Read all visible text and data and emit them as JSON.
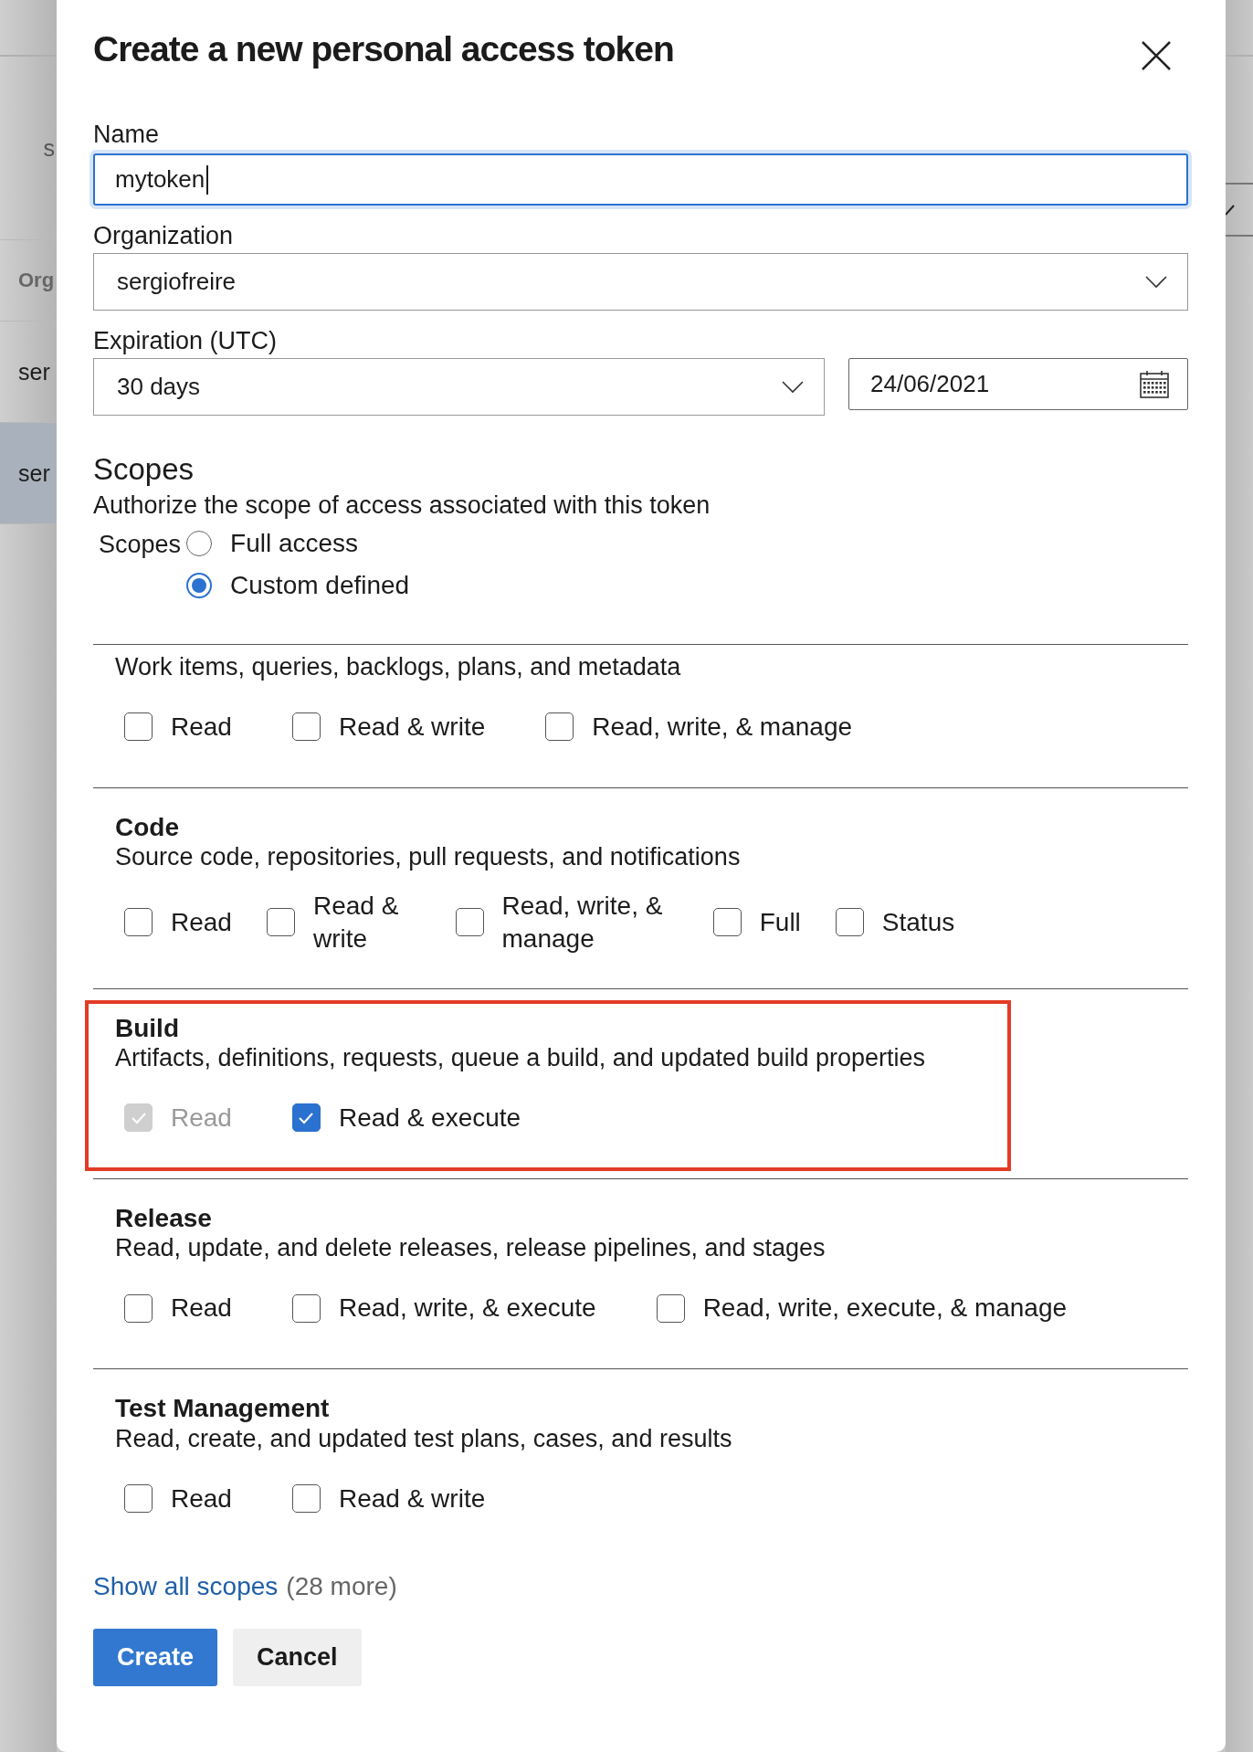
{
  "background": {
    "left_texts": [
      {
        "text": "s",
        "kind": "plain",
        "selected": false
      },
      {
        "text": "Org",
        "kind": "header",
        "selected": false
      },
      {
        "text": "ser",
        "kind": "row",
        "selected": false
      },
      {
        "text": "ser",
        "kind": "row",
        "selected": true
      }
    ]
  },
  "dialog": {
    "title": "Create a new personal access token",
    "name": {
      "label": "Name",
      "value": "mytoken"
    },
    "organization": {
      "label": "Organization",
      "value": "sergiofreire"
    },
    "expiration": {
      "label": "Expiration (UTC)",
      "value": "30 days",
      "date": "24/06/2021"
    },
    "scopes": {
      "heading": "Scopes",
      "description": "Authorize the scope of access associated with this token",
      "radio_label": "Scopes",
      "radios": [
        {
          "label": "Full access",
          "selected": false
        },
        {
          "label": "Custom defined",
          "selected": true
        }
      ],
      "sections": [
        {
          "description": "Work items, queries, backlogs, plans, and metadata",
          "highlighted": false,
          "options": [
            {
              "label": "Read",
              "checked": false,
              "disabled": false
            },
            {
              "label": "Read & write",
              "checked": false,
              "disabled": false
            },
            {
              "label": "Read, write, & manage",
              "checked": false,
              "disabled": false
            }
          ]
        },
        {
          "title": "Code",
          "description": "Source code, repositories, pull requests, and notifications",
          "highlighted": false,
          "options": [
            {
              "label": "Read",
              "checked": false,
              "disabled": false
            },
            {
              "label": "Read & write",
              "checked": false,
              "disabled": false
            },
            {
              "label": "Read, write, & manage",
              "checked": false,
              "disabled": false
            },
            {
              "label": "Full",
              "checked": false,
              "disabled": false
            },
            {
              "label": "Status",
              "checked": false,
              "disabled": false
            }
          ]
        },
        {
          "title": "Build",
          "description": "Artifacts, definitions, requests, queue a build, and updated build properties",
          "highlighted": true,
          "options": [
            {
              "label": "Read",
              "checked": true,
              "disabled": true
            },
            {
              "label": "Read & execute",
              "checked": true,
              "disabled": false
            }
          ]
        },
        {
          "title": "Release",
          "description": "Read, update, and delete releases, release pipelines, and stages",
          "highlighted": false,
          "options": [
            {
              "label": "Read",
              "checked": false,
              "disabled": false
            },
            {
              "label": "Read, write, & execute",
              "checked": false,
              "disabled": false
            },
            {
              "label": "Read, write, execute, & manage",
              "checked": false,
              "disabled": false
            }
          ]
        },
        {
          "title": "Test Management",
          "description": "Read, create, and updated test plans, cases, and results",
          "highlighted": false,
          "options": [
            {
              "label": "Read",
              "checked": false,
              "disabled": false
            },
            {
              "label": "Read & write",
              "checked": false,
              "disabled": false
            }
          ]
        }
      ],
      "show_all": {
        "link": "Show all scopes",
        "count": "(28 more)"
      }
    },
    "buttons": [
      {
        "label": "Create",
        "kind": "primary"
      },
      {
        "label": "Cancel",
        "kind": "secondary"
      }
    ]
  }
}
